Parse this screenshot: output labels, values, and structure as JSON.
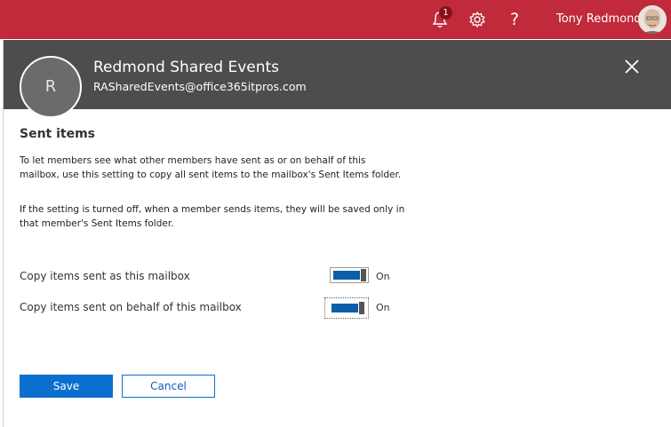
{
  "topbar": {
    "notifications_count": "1",
    "user_name": "Tony Redmond",
    "help_glyph": "?",
    "bg_color": "#c02a3a"
  },
  "panel": {
    "avatar_initial": "R",
    "mailbox_name": "Redmond Shared Events",
    "mailbox_email": "RASharedEvents@office365itpros.com",
    "header_bg_color": "#4d4d4d"
  },
  "section": {
    "title": "Sent items",
    "desc1_line1": "To let members see what other members have sent as or on behalf of this",
    "desc1_line2": "mailbox, use this setting to copy all sent items to the mailbox's Sent Items folder.",
    "desc2_line1": "If the setting is turned off, when a member sends items, they will be saved only in",
    "desc2_line2": "that member's Sent Items folder."
  },
  "settings": [
    {
      "label": "Copy items sent as this mailbox",
      "state": "On",
      "enabled": true
    },
    {
      "label": "Copy items sent on behalf of this mailbox",
      "state": "On",
      "enabled": true
    }
  ],
  "buttons": {
    "save": "Save",
    "cancel": "Cancel"
  },
  "accent_color": "#0b6fce",
  "icons": [
    "bell-icon",
    "gear-icon",
    "help-icon",
    "close-icon"
  ]
}
